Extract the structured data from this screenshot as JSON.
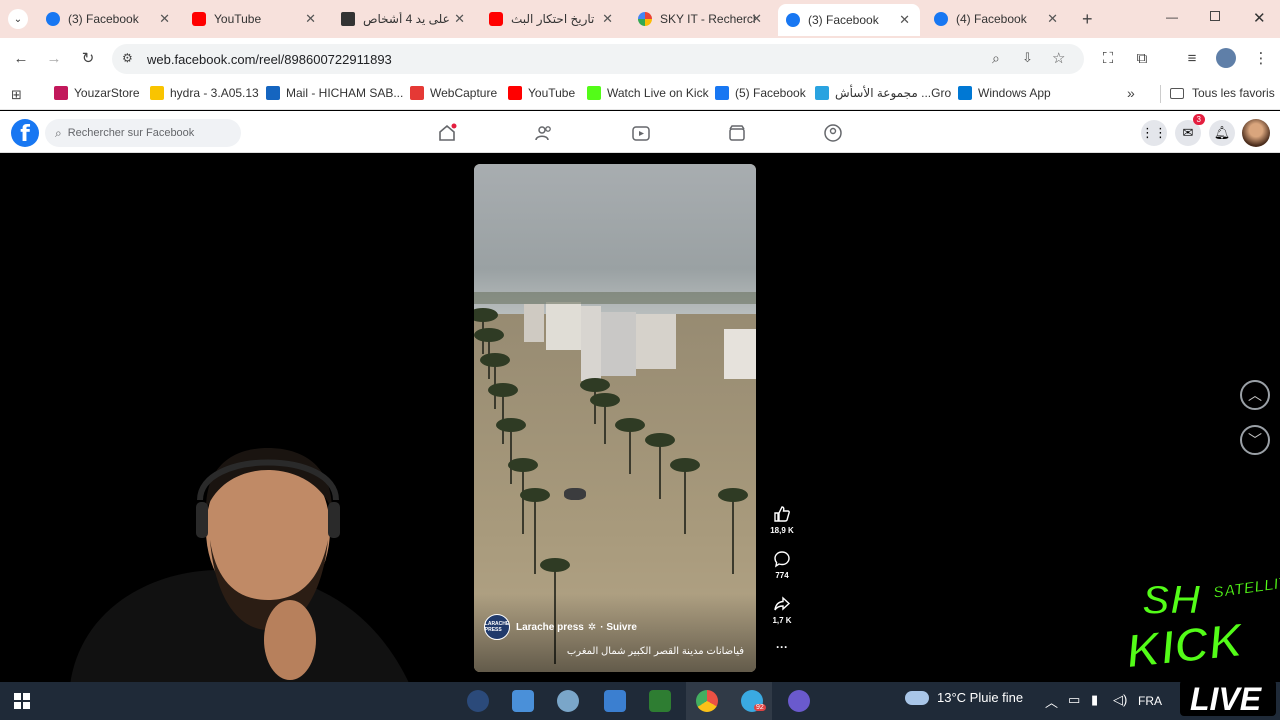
{
  "browser": {
    "tabs": [
      {
        "title": "(3) Facebook",
        "icon": "facebook-icon",
        "active": false
      },
      {
        "title": "YouTube",
        "icon": "youtube-icon",
        "active": false
      },
      {
        "title": "على يد 4 أشخاص",
        "icon": "news-icon",
        "active": false
      },
      {
        "title": "تاريخ احتكار البث",
        "icon": "youtube-icon",
        "active": false
      },
      {
        "title": "SKY IT - Recherche",
        "icon": "google-icon",
        "active": false
      },
      {
        "title": "(3) Facebook",
        "icon": "facebook-icon",
        "active": true
      },
      {
        "title": "(4) Facebook",
        "icon": "facebook-icon",
        "active": false
      }
    ],
    "new_tab": "+",
    "url": "web.facebook.com/reel/898600722911893",
    "bookmarks": [
      {
        "label": "YouzarStore",
        "color": "#c2185b"
      },
      {
        "label": "hydra - 3.A05.13",
        "color": "#f9c400"
      },
      {
        "label": "Mail - HICHAM SAB...",
        "color": "#1565c0"
      },
      {
        "label": "WebCapture",
        "color": "#e53935"
      },
      {
        "label": "YouTube",
        "color": "#ff0000"
      },
      {
        "label": "Watch Live on Kick",
        "color": "#53fc18"
      },
      {
        "label": "(5) Facebook",
        "color": "#1877f2"
      },
      {
        "label": "مجموعة الأسأش ...Gro",
        "color": "#2aa3e0"
      },
      {
        "label": "Windows App",
        "color": "#0078d4"
      }
    ],
    "more_bookmarks": "»",
    "all_bookmarks": "Tous les favoris"
  },
  "facebook": {
    "search_placeholder": "Rechercher sur Facebook",
    "notification_count": "3",
    "reel": {
      "author": "Larache press",
      "follow": "· Suivre",
      "avatar_text": "LARACHE PRESS",
      "caption": "فياضانات مدينة القصر الكبير شمال المغرب",
      "likes": "18,9 K",
      "comments": "774",
      "shares": "1,7 K",
      "more": "···"
    }
  },
  "taskbar": {
    "weather": "13°C  Pluie fine",
    "language": "FRA",
    "telegram_badge": "92"
  },
  "overlay": {
    "kick_text": "KICK",
    "live_text": "LIVE",
    "satellite_text": "SATELLITE",
    "sh_text": "SH"
  }
}
